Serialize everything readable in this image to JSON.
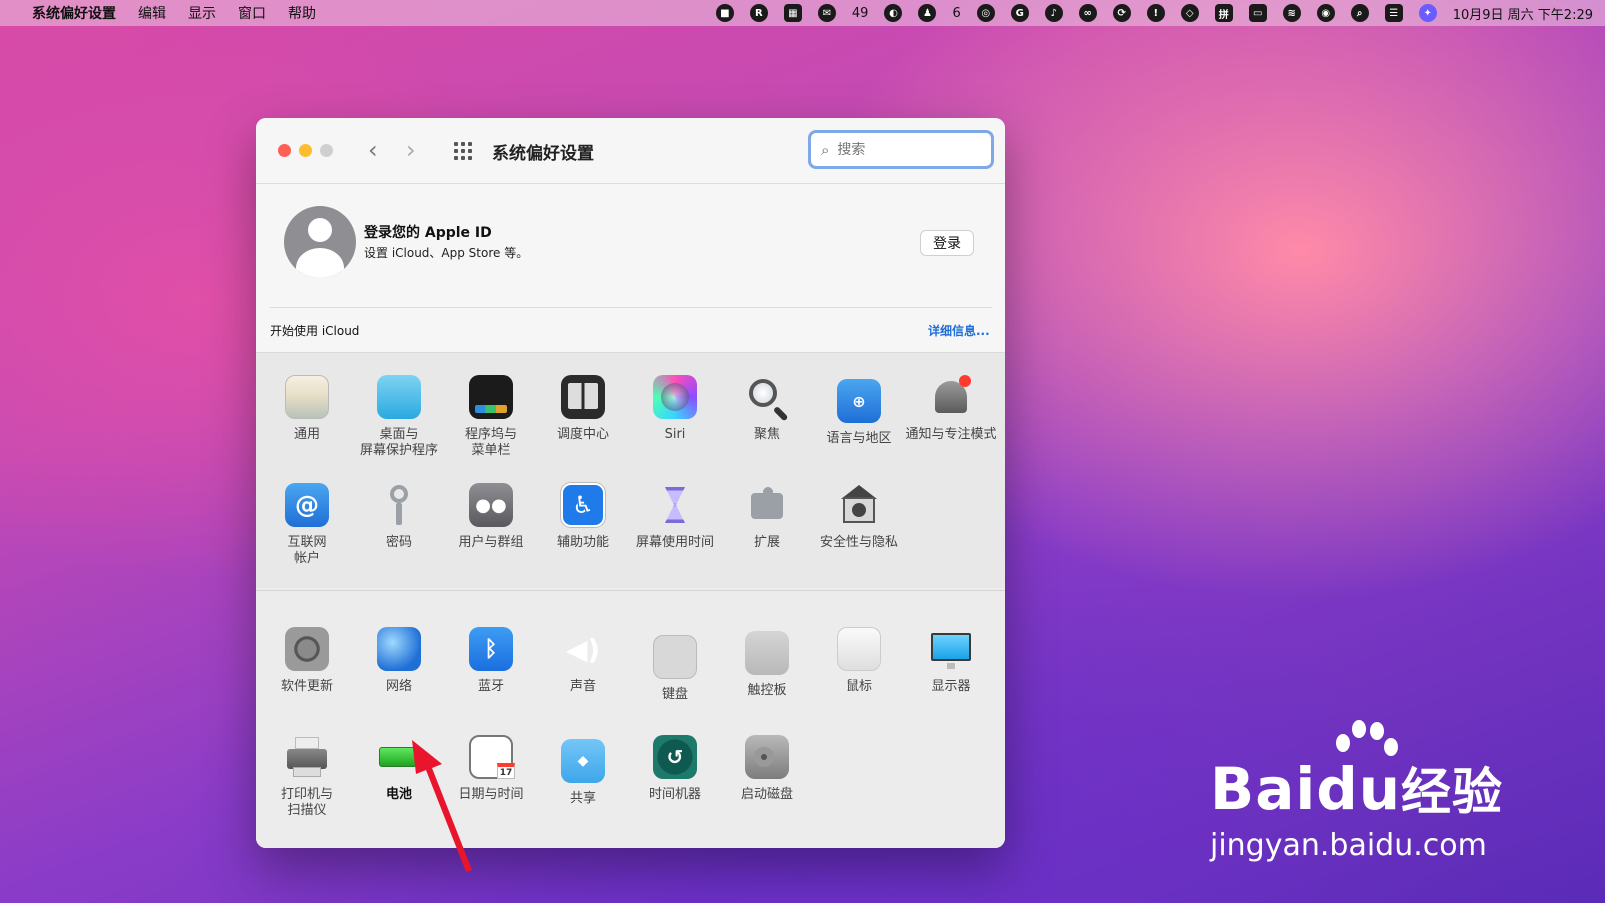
{
  "menubar": {
    "app_name": "系统偏好设置",
    "menus": [
      "编辑",
      "显示",
      "窗口",
      "帮助"
    ],
    "wechat_count": "49",
    "qq_count": "6",
    "datetime": "10月9日 周六 下午2:29"
  },
  "window": {
    "title": "系统偏好设置",
    "search_placeholder": "搜索"
  },
  "account": {
    "title": "登录您的 Apple ID",
    "subtitle": "设置 iCloud、App Store 等。",
    "login_button": "登录",
    "icloud_label": "开始使用 iCloud",
    "details_link": "详细信息..."
  },
  "prefs": {
    "row1": [
      "通用",
      "桌面与\n屏幕保护程序",
      "程序坞与\n菜单栏",
      "调度中心",
      "Siri",
      "聚焦",
      "语言与地区",
      "通知与专注模式"
    ],
    "row2": [
      "互联网\n帐户",
      "密码",
      "用户与群组",
      "辅助功能",
      "屏幕使用时间",
      "扩展",
      "安全性与隐私"
    ],
    "row3": [
      "软件更新",
      "网络",
      "蓝牙",
      "声音",
      "键盘",
      "触控板",
      "鼠标",
      "显示器"
    ],
    "row4": [
      "打印机与\n扫描仪",
      "电池",
      "日期与时间",
      "共享",
      "时间机器",
      "启动磁盘"
    ]
  },
  "calendar_day": "17",
  "watermark": {
    "brand_a": "Bai",
    "brand_b": "du",
    "brand_c": "经验",
    "url": "jingyan.baidu.com"
  },
  "colors": {
    "accent": "#1f6fd6",
    "close": "#fe5f57",
    "minimize": "#febc2e",
    "arrow": "#e8152c"
  }
}
